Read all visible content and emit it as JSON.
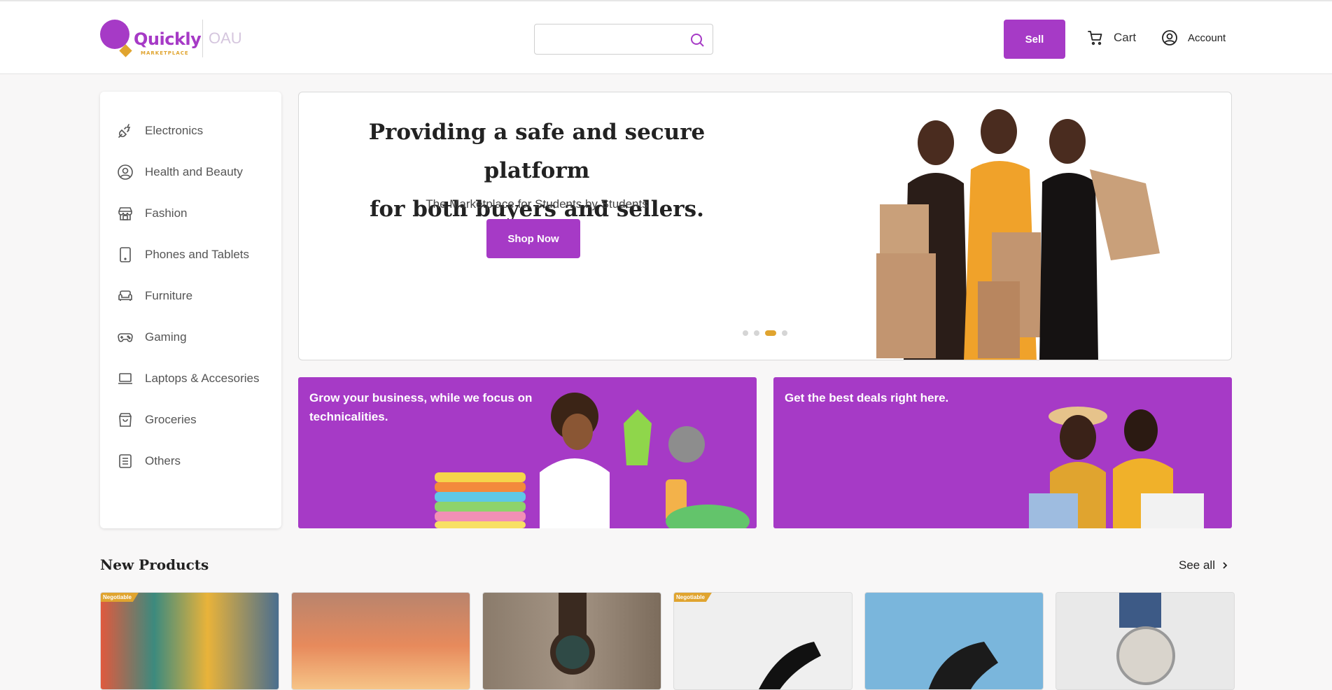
{
  "header": {
    "logo_word": "Quickly",
    "logo_sub": "MARKETPLACE",
    "campus": "OAU",
    "search_placeholder": "",
    "sell_label": "Sell",
    "cart_label": "Cart",
    "account_label": "Account"
  },
  "sidebar": {
    "items": [
      {
        "label": "Electronics",
        "icon": "plug-icon"
      },
      {
        "label": "Health and Beauty",
        "icon": "user-circle-icon"
      },
      {
        "label": "Fashion",
        "icon": "store-icon"
      },
      {
        "label": "Phones and Tablets",
        "icon": "tablet-icon"
      },
      {
        "label": "Furniture",
        "icon": "sofa-icon"
      },
      {
        "label": "Gaming",
        "icon": "gamepad-icon"
      },
      {
        "label": "Laptops & Accesories",
        "icon": "laptop-icon"
      },
      {
        "label": "Groceries",
        "icon": "shopping-bag-icon"
      },
      {
        "label": "Others",
        "icon": "list-icon"
      }
    ]
  },
  "hero": {
    "title_line1": "Providing a safe and secure platform",
    "title_line2": "for both buyers and sellers.",
    "subtitle": "The Marketplace for Students by Students",
    "cta_label": "Shop Now",
    "active_slide": 3,
    "slide_count": 4
  },
  "promos": {
    "left_text": "Grow your business, while we focus on technicalities.",
    "right_text": "Get the best deals right here."
  },
  "new_products": {
    "title": "New Products",
    "see_all_label": "See all",
    "items": [
      {
        "tag": "Negotiable"
      },
      {
        "tag": ""
      },
      {
        "tag": ""
      },
      {
        "tag": "Negotiable"
      },
      {
        "tag": ""
      },
      {
        "tag": ""
      }
    ]
  },
  "colors": {
    "brand_purple": "#a63ac6",
    "brand_orange": "#e0a42f"
  }
}
